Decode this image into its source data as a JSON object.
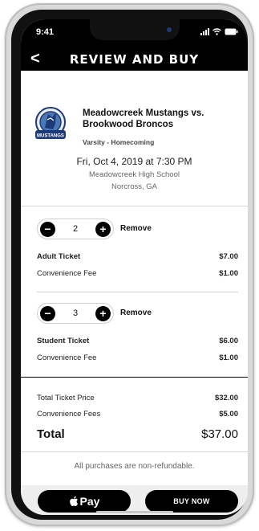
{
  "status_bar": {
    "time": "9:41"
  },
  "header": {
    "back_glyph": "<",
    "title": "REVIEW AND BUY"
  },
  "event": {
    "logo_alt": "Meadowcreek Mustangs logo",
    "name": "Meadowcreek Mustangs vs. Brookwood Broncos",
    "level": "Varsity - Homecoming",
    "date": "Fri, Oct 4, 2019 at 7:30 PM",
    "venue": "Meadowcreek High School",
    "city": "Norcross, GA"
  },
  "tickets": [
    {
      "quantity": "2",
      "remove_label": "Remove",
      "name": "Adult Ticket",
      "price": "$7.00",
      "fee_label": "Convenience Fee",
      "fee": "$1.00"
    },
    {
      "quantity": "3",
      "remove_label": "Remove",
      "name": "Student Ticket",
      "price": "$6.00",
      "fee_label": "Convenience Fee",
      "fee": "$1.00"
    }
  ],
  "summary": {
    "total_ticket_price_label": "Total Ticket Price",
    "total_ticket_price": "$32.00",
    "convenience_fees_label": "Convenience Fees",
    "convenience_fees": "$5.00",
    "total_label": "Total",
    "total": "$37.00"
  },
  "note": "All purchases are non-refundable.",
  "actions": {
    "apple_pay_label": "Pay",
    "buy_now_label": "BUY NOW"
  },
  "colors": {
    "primary": "#000000",
    "background": "#ffffff",
    "muted_text": "#666666",
    "bar": "#eeeeee"
  }
}
